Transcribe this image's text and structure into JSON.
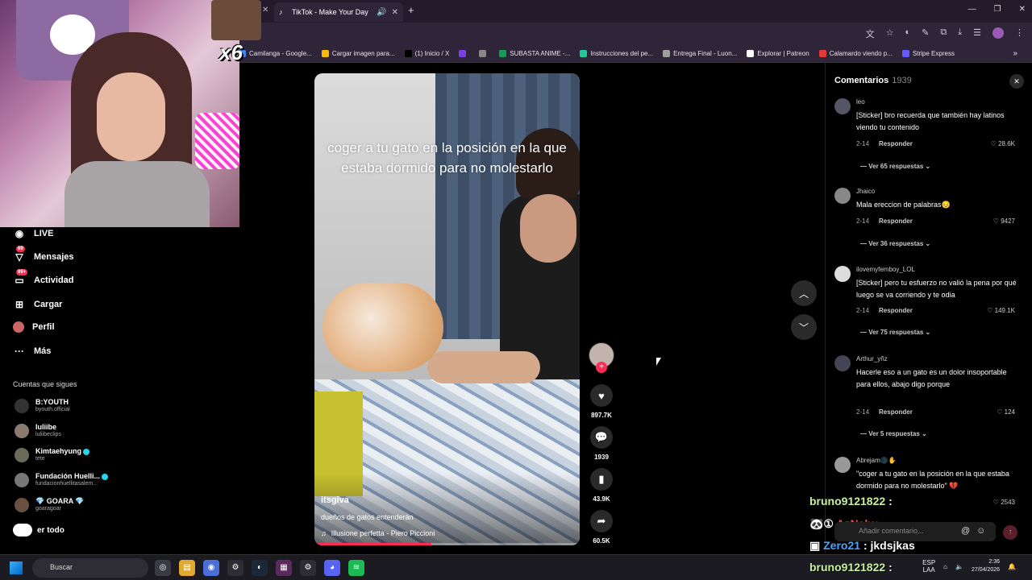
{
  "browser": {
    "tab_title": "TikTok - Make Your Day",
    "tab_close": "✕",
    "new_tab": "+",
    "bookmarks": [
      {
        "label": "Camilanga - Google...",
        "color": "#4285f4"
      },
      {
        "label": "Cargar imagen para...",
        "color": "#fbbc05"
      },
      {
        "label": "(1) Inicio / X",
        "color": "#000000"
      },
      {
        "label": "",
        "color": "#7b3fe4"
      },
      {
        "label": "",
        "color": "#888888"
      },
      {
        "label": "SUBASTA ANIME -...",
        "color": "#0f9d58"
      },
      {
        "label": "Instrucciones del pe...",
        "color": "#20c997"
      },
      {
        "label": "Entrega Final - Luon...",
        "color": "#9e9e9e"
      },
      {
        "label": "Explorar | Patreon",
        "color": "#ffffff"
      },
      {
        "label": "Calamardo viendo p...",
        "color": "#e53935"
      },
      {
        "label": "Stripe Express",
        "color": "#635bff"
      }
    ]
  },
  "overlay": {
    "emote_text": "x6"
  },
  "sidebar": {
    "nav": [
      {
        "label": "LIVE",
        "icon": "live-icon",
        "badge": ""
      },
      {
        "label": "Mensajes",
        "icon": "messages-icon",
        "badge": "69"
      },
      {
        "label": "Actividad",
        "icon": "activity-icon",
        "badge": "99+"
      },
      {
        "label": "Cargar",
        "icon": "upload-icon",
        "badge": ""
      },
      {
        "label": "Perfil",
        "icon": "profile-icon",
        "badge": ""
      },
      {
        "label": "Más",
        "icon": "more-icon",
        "badge": ""
      }
    ],
    "following_title": "Cuentas que sigues",
    "accounts": [
      {
        "name": "B:YOUTH",
        "user": "byouth.official",
        "verified": false
      },
      {
        "name": "luliibe",
        "user": "luliibeclips",
        "verified": false
      },
      {
        "name": "Kimtaehyung",
        "user": "tete",
        "verified": true
      },
      {
        "name": "Fundación Huelli...",
        "user": "fundacionhuellitasalem...",
        "verified": true
      },
      {
        "name": "💎 GOARA 💎",
        "user": "goaragoar",
        "verified": false
      }
    ],
    "see_all": "er todo"
  },
  "video": {
    "caption": "coger a tu gato en la posición en la que estaba dormido para no molestarlo",
    "author": "itsgiva",
    "description": "dueños de gatos entenderán",
    "music": "Illusione perfetta - Piero Piccioni",
    "progress": 0.44
  },
  "actions": {
    "likes": "897.7K",
    "comments": "1939",
    "saves": "43.9K",
    "shares": "60.5K"
  },
  "comments_panel": {
    "title": "Comentarios",
    "count": "1939",
    "reply_label": "Responder",
    "input_placeholder": "Añadir comentario...",
    "items": [
      {
        "user": "leo",
        "text": "[Sticker] bro recuerda que también hay latinos viendo tu contenido",
        "date": "2-14",
        "likes": "28.6K",
        "more": "Ver 65 respuestas"
      },
      {
        "user": "Jhaico",
        "text": "Mala ereccion de palabras😔",
        "date": "2-14",
        "likes": "9427",
        "more": "Ver 36 respuestas"
      },
      {
        "user": "ilovemyfemboy_LOL",
        "text": "[Sticker] pero tu esfuerzo no valió la pena por qué luego se va corriendo y te odia",
        "date": "2-14",
        "likes": "149.1K",
        "more": "Ver 75 respuestas"
      },
      {
        "user": "Arthur_yñz",
        "text": "Hacerle eso a un gato es un dolor insoportable para ellos, abajo digo porque",
        "date": "2-14",
        "likes": "124",
        "more": "Ver 5 respuestas"
      },
      {
        "user": "Abrejam🌑✋",
        "text": "\"coger a tu gato en la posición en la que estaba dormido para no molestarlo\" 💔",
        "date": "",
        "likes": "2543",
        "more": ""
      }
    ]
  },
  "chat": [
    {
      "user": "bruno9121822",
      "msg": ":",
      "user_color": "#c7f0a0"
    },
    {
      "user": "AzNahu",
      "msg": ":",
      "user_color": "#ff3b3b"
    },
    {
      "user": "Zero21",
      "msg": ": jkdsjkas",
      "user_color": "#4aa3ff"
    },
    {
      "user": "bruno9121822",
      "msg": ":",
      "user_color": "#c7f0a0"
    }
  ],
  "taskbar": {
    "search_placeholder": "Buscar",
    "lang_line1": "ESP",
    "lang_line2": "LAA",
    "time": "2:36",
    "date": "27/04/2026"
  }
}
